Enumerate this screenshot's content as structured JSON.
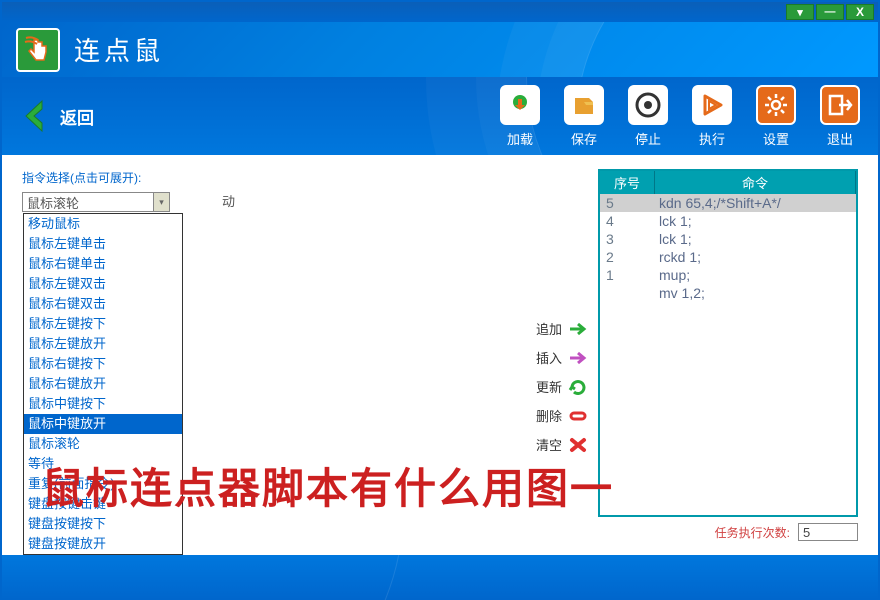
{
  "window": {
    "minimize": "—",
    "close": "X"
  },
  "app": {
    "title": "连点鼠"
  },
  "toolbar": {
    "back": "返回",
    "buttons": [
      {
        "label": "加载",
        "name": "load-button",
        "bg": "#ffffff",
        "icon": "load"
      },
      {
        "label": "保存",
        "name": "save-button",
        "bg": "#ffffff",
        "icon": "save"
      },
      {
        "label": "停止",
        "name": "stop-button",
        "bg": "#ffffff",
        "icon": "stop"
      },
      {
        "label": "执行",
        "name": "run-button",
        "bg": "#ffffff",
        "icon": "run"
      },
      {
        "label": "设置",
        "name": "settings-button",
        "bg": "#e56a1a",
        "icon": "settings"
      },
      {
        "label": "退出",
        "name": "exit-button",
        "bg": "#e56a1a",
        "icon": "exit"
      }
    ]
  },
  "left": {
    "section_label": "指令选择(点击可展开):",
    "combo_value": "鼠标滚轮",
    "dropdown": [
      "移动鼠标",
      "鼠标左键单击",
      "鼠标右键单击",
      "鼠标左键双击",
      "鼠标右键双击",
      "鼠标左键按下",
      "鼠标左键放开",
      "鼠标右键按下",
      "鼠标右键放开",
      "鼠标中键按下",
      "鼠标中键放开",
      "鼠标滚轮",
      "等待",
      "重复(前面指令)",
      "键盘按键击键",
      "键盘按键按下",
      "键盘按键放开"
    ],
    "selected_index": 10
  },
  "middle": {
    "hint": "动"
  },
  "actions": [
    {
      "label": "追加",
      "name": "append-action",
      "icon": "append"
    },
    {
      "label": "插入",
      "name": "insert-action",
      "icon": "insert"
    },
    {
      "label": "更新",
      "name": "update-action",
      "icon": "update"
    },
    {
      "label": "删除",
      "name": "delete-action",
      "icon": "delete"
    },
    {
      "label": "清空",
      "name": "clear-action",
      "icon": "clear"
    }
  ],
  "table": {
    "head_seq": "序号",
    "head_cmd": "命令",
    "rows": [
      {
        "seq": "5",
        "cmd": "kdn 65,4;",
        "comment": "/*Shift+A*/",
        "hl": true
      },
      {
        "seq": "4",
        "cmd": "lck 1;",
        "comment": "",
        "hl": false
      },
      {
        "seq": "3",
        "cmd": "lck 1;",
        "comment": "",
        "hl": false
      },
      {
        "seq": "2",
        "cmd": "rckd 1;",
        "comment": "",
        "hl": false
      },
      {
        "seq": "1",
        "cmd": "mup;",
        "comment": "",
        "hl": false
      },
      {
        "seq": "",
        "cmd": "mv  1,2;",
        "comment": "",
        "hl": false
      }
    ]
  },
  "exec": {
    "label": "任务执行次数:",
    "value": "5"
  },
  "watermark": "鼠标连点器脚本有什么用图一"
}
